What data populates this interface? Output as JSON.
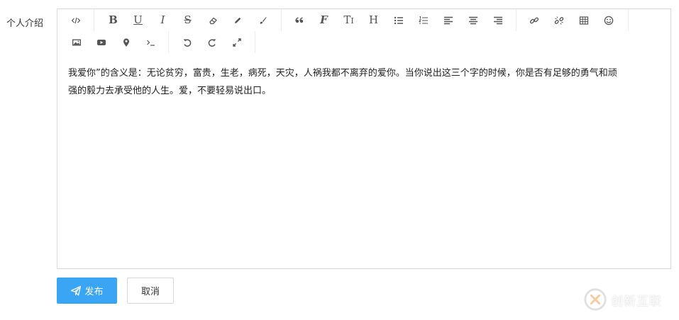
{
  "form": {
    "label": "个人介绍"
  },
  "editor": {
    "toolbar_row1": [
      {
        "icon": "code-view-icon",
        "name": "source-code-button"
      },
      {
        "icon": "bold-icon",
        "name": "bold-button"
      },
      {
        "icon": "underline-icon",
        "name": "underline-button"
      },
      {
        "icon": "italic-icon",
        "name": "italic-button"
      },
      {
        "icon": "strikethrough-icon",
        "name": "strikethrough-button"
      },
      {
        "icon": "eraser-icon",
        "name": "clear-format-button"
      },
      {
        "icon": "pencil-icon",
        "name": "font-color-button"
      },
      {
        "icon": "brush-icon",
        "name": "background-color-button"
      },
      {
        "icon": "quote-icon",
        "name": "blockquote-button"
      },
      {
        "icon": "font-icon",
        "name": "font-family-button"
      },
      {
        "icon": "font-size-icon",
        "name": "font-size-button"
      },
      {
        "icon": "heading-icon",
        "name": "heading-button"
      },
      {
        "icon": "bullet-list-icon",
        "name": "bullet-list-button"
      },
      {
        "icon": "numbered-list-icon",
        "name": "numbered-list-button"
      },
      {
        "icon": "align-left-icon",
        "name": "align-left-button"
      },
      {
        "icon": "align-center-icon",
        "name": "align-center-button"
      },
      {
        "icon": "align-right-icon",
        "name": "align-right-button"
      },
      {
        "icon": "link-icon",
        "name": "insert-link-button"
      },
      {
        "icon": "unlink-icon",
        "name": "unlink-button"
      },
      {
        "icon": "table-icon",
        "name": "insert-table-button"
      },
      {
        "icon": "emoji-icon",
        "name": "emoji-button"
      }
    ],
    "toolbar_row2": [
      {
        "icon": "image-icon",
        "name": "insert-image-button"
      },
      {
        "icon": "video-icon",
        "name": "insert-video-button"
      },
      {
        "icon": "location-icon",
        "name": "insert-location-button"
      },
      {
        "icon": "terminal-icon",
        "name": "insert-code-button"
      },
      {
        "icon": "undo-icon",
        "name": "undo-button"
      },
      {
        "icon": "redo-icon",
        "name": "redo-button"
      },
      {
        "icon": "fullscreen-icon",
        "name": "fullscreen-button"
      }
    ],
    "content_line1": "我爱你”的含义是：无论贫穷，富贵，生老，病死，天灾，人祸我都不离弃的爱你。当你说出这三个字的时候，你是否有足够的勇气和顽",
    "content_line2": "强的毅力去承受他的人生。爱，不要轻易说出口。"
  },
  "actions": {
    "publish_label": "发布",
    "cancel_label": "取消"
  },
  "watermark": {
    "text": "创新互联"
  },
  "colors": {
    "primary": "#3aa5f5",
    "border": "#d9d9d9",
    "icon": "#555555"
  }
}
